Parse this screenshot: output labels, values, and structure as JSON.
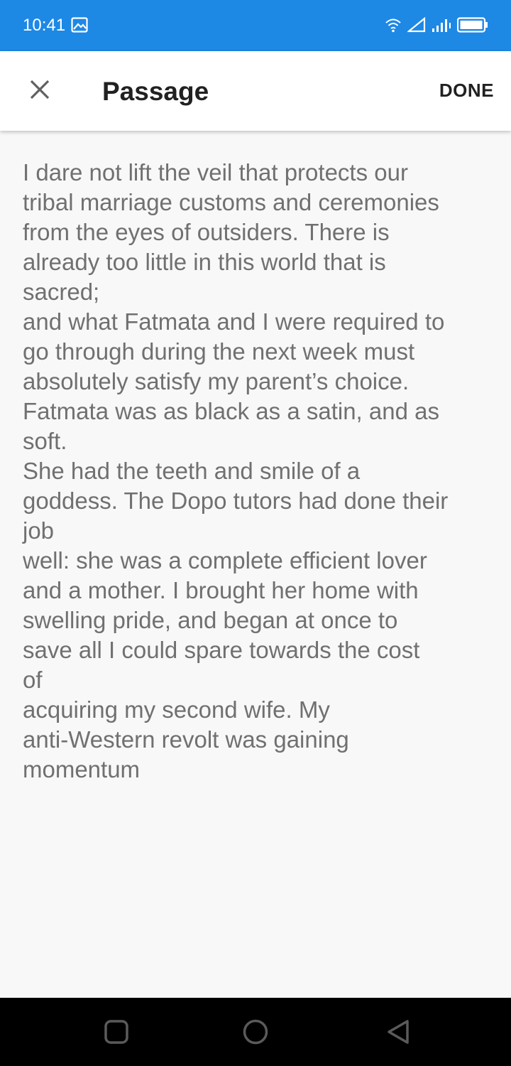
{
  "status_bar": {
    "time": "10:41",
    "left_icon": "image-icon",
    "right_icons": [
      "wifi-icon",
      "signal-icon",
      "signal-bars-icon",
      "battery-icon"
    ],
    "background": "#1e88e5"
  },
  "app_bar": {
    "close_icon": "close-icon",
    "title": "Passage",
    "done_label": "DONE"
  },
  "passage": {
    "lines": [
      "I dare not lift the veil that protects our",
      "tribal marriage customs and ceremonies",
      "from the eyes of outsiders. There is",
      "already too little in this world that is",
      "sacred;",
      "and what Fatmata and I were required to",
      "go through during the next week must",
      "absolutely satisfy my parent’s choice.",
      "Fatmata was as black as a satin, and as",
      "soft.",
      "She had the teeth and smile of a",
      "goddess. The Dopo tutors had done their",
      "job",
      "well: she was a complete efficient lover",
      "and a mother. I brought her home with",
      "swelling pride, and began at once to",
      "save all I could spare towards the cost",
      "of",
      "acquiring my second wife. My",
      "anti-Western revolt was gaining",
      "momentum"
    ],
    "text_color": "#707070"
  },
  "nav_bar": {
    "buttons": [
      "recents-square-icon",
      "home-circle-icon",
      "back-triangle-icon"
    ]
  }
}
